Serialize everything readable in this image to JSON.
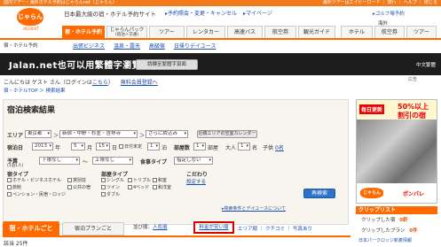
{
  "top_bar": {
    "left_text": "国内ツアー・海外ホテル予約はじゃらんnet（じゃらん）",
    "right_text": "海外ツアーはエイビーロード ｜ 旅行 ｜ ヘルプ ｜ 閉じる"
  },
  "header": {
    "logo_text": "じゃらん",
    "logo_sub": "RECRUIT",
    "site_title": "日本最大級の宿・ホテル予約サイト",
    "links": [
      "▸予約照会・変更・キャンセル",
      "▸マイページ"
    ],
    "golf_link": "▸ゴルフ場予約",
    "overseas_label": "海外"
  },
  "main_nav": [
    {
      "label": "宿・ホテル予約",
      "active": true
    },
    {
      "label": "じゃらんパック",
      "sub": "(宿泊＋交通)",
      "active": false
    },
    {
      "label": "ツアー",
      "active": false
    },
    {
      "label": "レンタカー",
      "active": false
    },
    {
      "label": "高速バス",
      "active": false
    },
    {
      "label": "航空券",
      "active": false
    },
    {
      "label": "観光ガイド",
      "active": false
    },
    {
      "label": "ホテル",
      "active": false
    },
    {
      "label": "航空券",
      "active": false
    },
    {
      "label": "ツアー",
      "active": false
    }
  ],
  "left_crumb": "宿・ホテル予約",
  "sub_nav": [
    "出張ビジネス",
    "温泉・露天",
    "高級宿",
    "日帰りデイユース"
  ],
  "banner": {
    "text": "Jalan.net也可以用繁體字瀏覽",
    "button": "請轉至繁體字頁面",
    "right_text": "中文繁體",
    "ad_label": "広告"
  },
  "greeting": {
    "text": "こんにちは ゲスト さん（ログインは",
    "login_link": "こちら",
    "mid": "）",
    "register_link": "無料会員登録へ"
  },
  "breadcrumb": "宿・ホテルTOP ＞ 検索結果",
  "search": {
    "title": "宿泊検索結果",
    "area_label": "エリア",
    "area_values": [
      "東京都",
      "新宿・中野・杉並・吉祥寺",
      "さらに絞込み"
    ],
    "area_button": "近隣エリアの空室カレンダー",
    "date_label": "宿泊日",
    "year": "2013",
    "year_unit": "年",
    "month": "5",
    "month_unit": "月",
    "day": "15",
    "day_unit": "日",
    "undecided": "日付未定",
    "nights": "1",
    "nights_unit": "泊",
    "rooms_label": "部屋数",
    "rooms": "1",
    "rooms_unit": "部屋",
    "adults_label": "大人",
    "adults": "1",
    "adults_unit": "名",
    "child_label": "子供",
    "child_link": "0名",
    "budget_label": "予算",
    "budget_sub": "(1泊1人)",
    "budget_min": "下限なし",
    "budget_sep": "〜",
    "budget_max": "上限なし",
    "meal_label": "食事タイプ",
    "meal_value": "指定しない",
    "inn_type_label": "宿タイプ",
    "inn_types": [
      "ホテル・ビジネスホテル",
      "旅館",
      "ペンション・民宿・ロッジ",
      "貸別荘",
      "公共の宿"
    ],
    "room_type_label": "部屋タイプ",
    "room_types": [
      "シングル",
      "ツイン",
      "ダブル",
      "トリプル",
      "4ベッド",
      "和室",
      "和洋室"
    ],
    "conditions_label": "こだわり",
    "conditions_link": "設定する",
    "search_button": "再検索",
    "note": "▸検索条件とデイユースについて"
  },
  "result_tabs": {
    "hotel_tab": "宿・ホテルごと",
    "plan_tab": "宿泊プランごと",
    "sort_prefix": "並び順：",
    "sort_popular": "人気順",
    "sort_cheap": "料金が安い順",
    "sort_rest": "エリア順 ｜ クチコミ ｜ 写真あり",
    "result_count": "該当 25件"
  },
  "sidebar_ad": {
    "badge": "毎日更新",
    "offer_line1": "50%以上",
    "offer_line2": "割引の宿",
    "logo_text": "じゃらん",
    "partner": "ポンパレ"
  },
  "clip": {
    "header": "クリップリスト",
    "hotels_label": "クリップした宿",
    "hotels_count": "0軒",
    "plans_label": "クリップしたプラン",
    "plans_count": "0件",
    "footer": "日本パークロッジ新着情報"
  },
  "colors": {
    "brand": "#ff6a00",
    "link": "#1a4fb0",
    "highlight": "#d60000",
    "button": "#2d73c9"
  }
}
